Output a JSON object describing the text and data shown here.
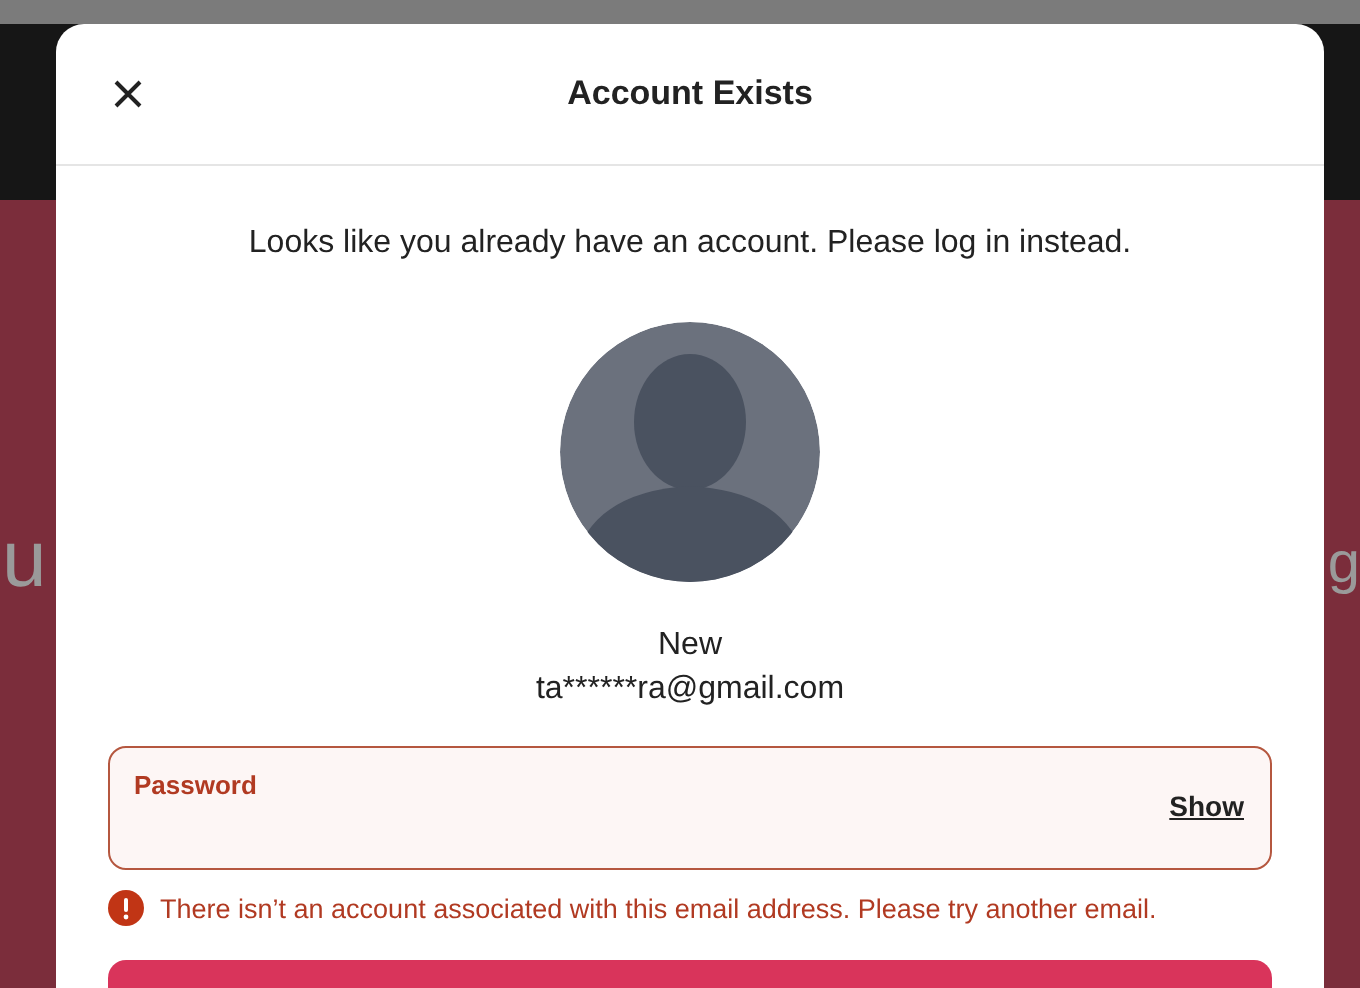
{
  "background": {
    "text_left": "u",
    "text_right": "g"
  },
  "modal": {
    "title": "Account Exists",
    "message": "Looks like you already have an account. Please log in instead.",
    "name": "New",
    "email": "ta******ra@gmail.com",
    "password_field": {
      "label": "Password",
      "show_label": "Show",
      "error": true
    },
    "error_message": "There isn’t an account associated with this email address. Please try another email."
  }
}
